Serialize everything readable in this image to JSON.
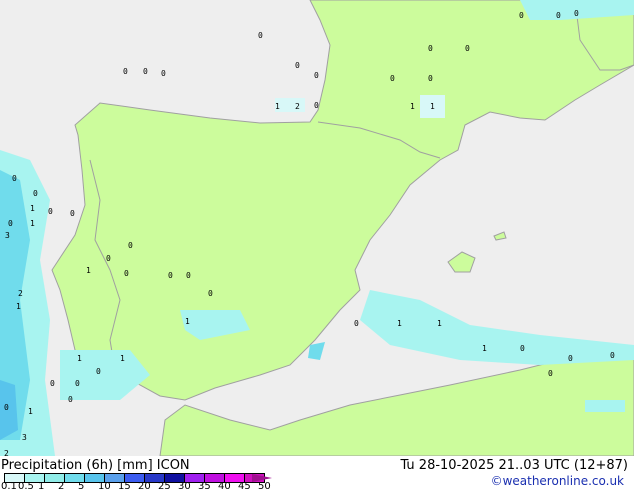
{
  "legend": {
    "title": "Precipitation (6h) [mm] ICON",
    "timestamp": "Tu 28-10-2025 21..03 UTC (12+87)",
    "credit": "©weatheronline.co.uk",
    "ticks": [
      "0.1",
      "0.5",
      "1",
      "2",
      "5",
      "10",
      "15",
      "20",
      "25",
      "30",
      "35",
      "40",
      "45",
      "50"
    ],
    "colors": [
      "#d8f8f8",
      "#a8f4f0",
      "#90ece8",
      "#70dcec",
      "#58c4ec",
      "#5aa0ec",
      "#3c5cf0",
      "#2838c8",
      "#1010a0",
      "#a020f0",
      "#c010e0",
      "#f010f0",
      "#d010c0"
    ]
  },
  "map": {
    "land_color": "#ccfc9c",
    "sea_color": "#eeeeee",
    "border_color": "#a0a0a0",
    "labels": [
      "0",
      "0",
      "0",
      "0",
      "0",
      "0",
      "1",
      "2",
      "0",
      "0",
      "0",
      "0",
      "0",
      "0",
      "0",
      "0",
      "1",
      "1",
      "0",
      "0",
      "1",
      "0",
      "3",
      "1",
      "0",
      "2",
      "1",
      "0",
      "0",
      "1",
      "0",
      "1",
      "0",
      "0",
      "0",
      "0",
      "1",
      "1",
      "0",
      "0",
      "0",
      "1",
      "3",
      "2",
      "0",
      "0",
      "0",
      "1",
      "1",
      "1",
      "0",
      "0",
      "0",
      "0"
    ]
  }
}
